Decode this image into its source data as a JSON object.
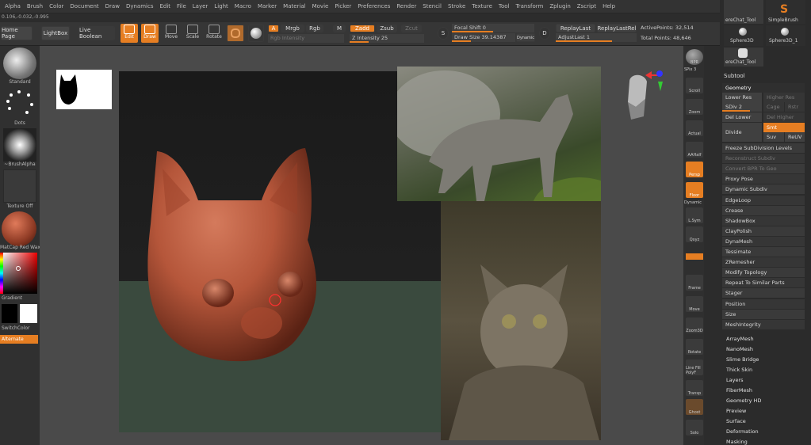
{
  "menu": [
    "Alpha",
    "Brush",
    "Color",
    "Document",
    "Draw",
    "Dynamics",
    "Edit",
    "File",
    "Layer",
    "Light",
    "Macro",
    "Marker",
    "Material",
    "Movie",
    "Picker",
    "Preferences",
    "Render",
    "Stencil",
    "Stroke",
    "Texture",
    "Tool",
    "Transform",
    "Zplugin",
    "Zscript",
    "Help"
  ],
  "coords": "0.106,-0.032,-0.995",
  "toolbar": {
    "home": "Home Page",
    "lightbox": "LightBox",
    "live_boolean": "Live Boolean",
    "edit": "Edit",
    "draw": "Draw",
    "move": "Move",
    "scale": "Scale",
    "rotate": "Rotate",
    "a": "A",
    "mrgb": "Mrgb",
    "rgb": "Rgb",
    "m": "M",
    "zadd": "Zadd",
    "zsub": "Zsub",
    "zcut": "Zcut",
    "rgb_intensity": "Rgb Intensity",
    "z_intensity": "Z Intensity 25",
    "focal_shift": "Focal Shift 0",
    "draw_size": "Draw Size 39.14387",
    "dynamic": "Dynamic",
    "replay_last": "ReplayLast",
    "replay_last_rel": "ReplayLastRel",
    "adjust_last": "AdjustLast 1",
    "active_points": "ActivePoints: 32,514",
    "total_points": "Total Points: 48,646"
  },
  "left": {
    "brush": "Standard",
    "stroke": "Dots",
    "alpha": "~BrushAlpha",
    "texture": "Texture Off",
    "material": "MatCap Red Wax",
    "gradient": "Gradient",
    "switch": "SwitchColor",
    "alternate": "Alternate"
  },
  "shelf": [
    "BPR",
    "SPix 3",
    "Scroll",
    "Zoom",
    "Actual",
    "AAHalf",
    "Persp",
    "Floor",
    "Dynamic",
    "L.Sym",
    "Qxyz",
    "Frame",
    "Move",
    "Zoom3D",
    "Rotate",
    "Line Fill PolyF",
    "Transp",
    "Ghost",
    "Solo"
  ],
  "tools": {
    "t1": "ereChat_Tool",
    "t2": "SimpleBrush",
    "t3": "Sphere3D",
    "t4": "Sphere3D_1",
    "t5": "ereChat_Tool"
  },
  "subtool": "Subtool",
  "geometry": {
    "title": "Geometry",
    "lower_res": "Lower Res",
    "higher_res": "Higher Res",
    "sdiv": "SDiv 2",
    "cage": "Cage",
    "rstr": "Rstr",
    "del_lower": "Del Lower",
    "del_higher": "Del Higher",
    "divide": "Divide",
    "smt": "Smt",
    "suv": "Suv",
    "reuv": "ReUV",
    "items": [
      "Freeze SubDivision Levels",
      "Reconstruct Subdiv",
      "Convert BPR To Geo",
      "Proxy Pose",
      "Dynamic Subdiv",
      "EdgeLoop",
      "Crease",
      "ShadowBox",
      "ClayPolish",
      "DynaMesh",
      "Tessimate",
      "ZRemesher",
      "Modify Topology",
      "Repeat To Similar Parts",
      "Stager",
      "Position",
      "Size",
      "MeshIntegrity"
    ],
    "dim": [
      1,
      2
    ]
  },
  "subpalettes": [
    "ArrayMesh",
    "NanoMesh",
    "Slime Bridge",
    "Thick Skin",
    "Layers",
    "FiberMesh",
    "Geometry HD",
    "Preview",
    "Surface",
    "Deformation",
    "Masking"
  ],
  "colors": {
    "accent": "#e67e22",
    "clay": "#b5563a"
  }
}
